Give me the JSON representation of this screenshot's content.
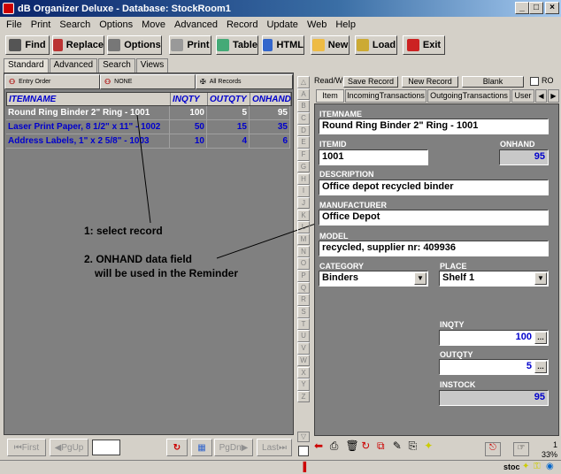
{
  "window": {
    "title": "dB Organizer Deluxe - Database: StockRoom1"
  },
  "menu": [
    "File",
    "Print",
    "Search",
    "Options",
    "Move",
    "Advanced",
    "Record",
    "Update",
    "Web",
    "Help"
  ],
  "toolbar": {
    "find": "Find",
    "replace": "Replace",
    "options": "Options",
    "print": "Print",
    "table": "Table",
    "html": "HTML",
    "new": "New",
    "load": "Load",
    "exit": "Exit"
  },
  "view_tabs": [
    "Standard",
    "Advanced",
    "Search",
    "Views"
  ],
  "filters": {
    "order": "Entry Order",
    "filter": "NONE",
    "records": "All Records"
  },
  "grid": {
    "headers": [
      "ITEMNAME",
      "INQTY",
      "OUTQTY",
      "ONHAND"
    ],
    "rows": [
      [
        "Round Ring Binder 2\" Ring - 1001",
        "100",
        "5",
        "95"
      ],
      [
        "Laser Print Paper, 8 1/2\" x 11\" - 1002",
        "50",
        "15",
        "35"
      ],
      [
        "Address Labels, 1\" x 2 5/8\" - 1003",
        "10",
        "4",
        "6"
      ]
    ]
  },
  "annotations": {
    "one": "1: select record",
    "two_a": "2. ONHAND data field",
    "two_b": "will be used in the Reminder"
  },
  "nav": {
    "first": "First",
    "pgup": "PgUp",
    "pgdn": "PgDn",
    "last": "Last"
  },
  "alphabet": [
    "A",
    "B",
    "C",
    "D",
    "E",
    "F",
    "G",
    "H",
    "I",
    "J",
    "K",
    "L",
    "M",
    "N",
    "O",
    "P",
    "Q",
    "R",
    "S",
    "T",
    "U",
    "V",
    "W",
    "X",
    "Y",
    "Z"
  ],
  "record_bar": {
    "readw": "Read/W",
    "save": "Save Record",
    "newrec": "New Record",
    "blank": "Blank",
    "ro": "RO"
  },
  "record_tabs": [
    "Item",
    "IncomingTransactions",
    "OutgoingTransactions",
    "User"
  ],
  "form": {
    "itemname_label": "ITEMNAME",
    "itemname": "Round Ring Binder 2\" Ring - 1001",
    "itemid_label": "ITEMID",
    "itemid": "1001",
    "onhand_label": "ONHAND",
    "onhand": "95",
    "description_label": "DESCRIPTION",
    "description": "Office depot recycled binder",
    "manufacturer_label": "MANUFACTURER",
    "manufacturer": "Office Depot",
    "model_label": "MODEL",
    "model": "recycled, supplier nr: 409936",
    "category_label": "CATEGORY",
    "category": "Binders",
    "place_label": "PLACE",
    "place": "Shelf 1",
    "inqty_label": "INQTY",
    "inqty": "100",
    "outqty_label": "OUTQTY",
    "outqty": "5",
    "instock_label": "INSTOCK",
    "instock": "95"
  },
  "status": {
    "right_num": "1",
    "zoom": "33%",
    "stoc": "stoc"
  }
}
